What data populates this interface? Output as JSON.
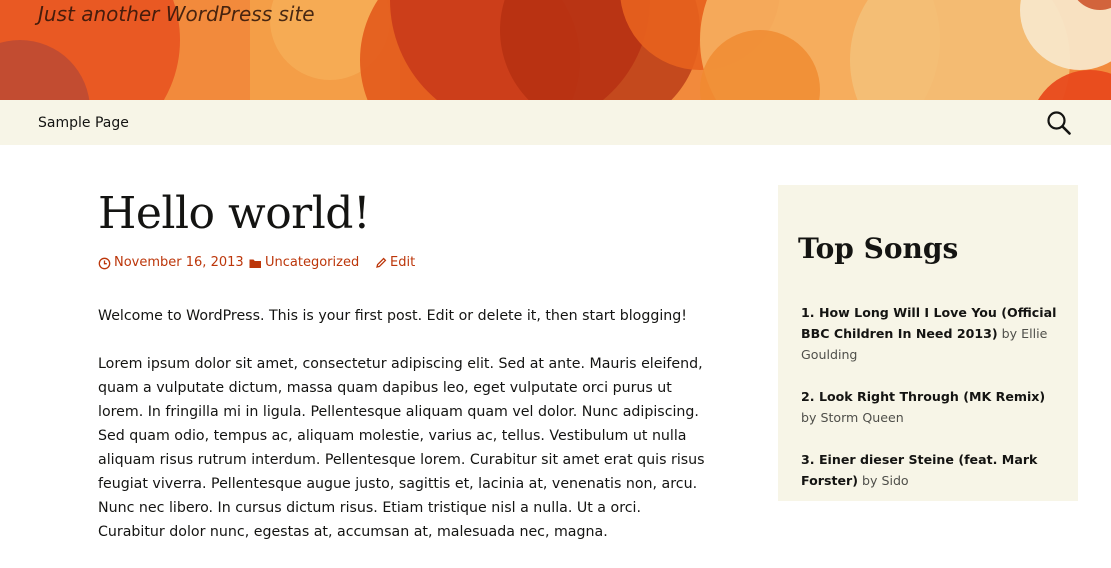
{
  "site": {
    "tagline": "Just another WordPress site"
  },
  "colors": {
    "accent": "#bc360a",
    "nav_bg": "#f7f5e7",
    "header_orange": "#f0843a"
  },
  "nav": {
    "items": [
      {
        "label": "Sample Page"
      }
    ],
    "search_icon": "search-icon"
  },
  "post": {
    "title": "Hello world!",
    "date": "November 16, 2013",
    "category": "Uncategorized",
    "edit": "Edit",
    "paragraphs": [
      "Welcome to WordPress. This is your first post. Edit or delete it, then start blogging!",
      "Lorem ipsum dolor sit amet, consectetur adipiscing elit. Sed at ante. Mauris eleifend, quam a vulputate dictum, massa quam dapibus leo, eget vulputate orci purus ut lorem. In fringilla mi in ligula. Pellentesque aliquam quam vel dolor. Nunc adipiscing. Sed quam odio, tempus ac, aliquam molestie, varius ac, tellus. Vestibulum ut nulla aliquam risus rutrum interdum. Pellentesque lorem. Curabitur sit amet erat quis risus feugiat viverra. Pellentesque augue justo, sagittis et, lacinia at, venenatis non, arcu. Nunc nec libero. In cursus dictum risus. Etiam tristique nisl a nulla. Ut a orci. Curabitur dolor nunc, egestas at, accumsan at, malesuada nec, magna."
    ]
  },
  "sidebar": {
    "title": "Top Songs",
    "songs": [
      {
        "num": "1.",
        "title": "How Long Will I Love You (Official BBC Children In Need 2013)",
        "by": "by Ellie Goulding"
      },
      {
        "num": "2.",
        "title": "Look Right Through (MK Remix)",
        "by": "by Storm Queen"
      },
      {
        "num": "3.",
        "title": "Einer dieser Steine (feat. Mark Forster)",
        "by": "by Sido"
      }
    ]
  }
}
